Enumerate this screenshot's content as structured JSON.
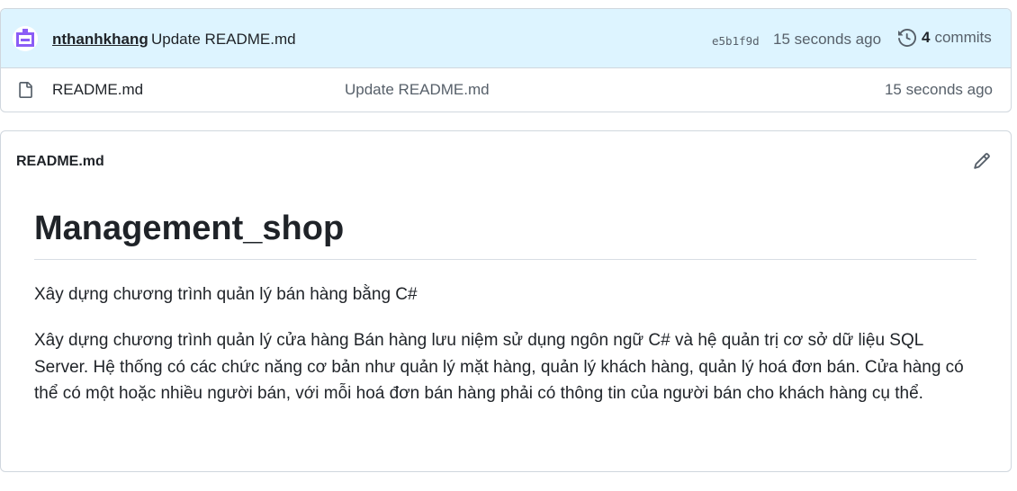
{
  "commit": {
    "author": "nthanhkhang",
    "message": "Update README.md",
    "sha": "e5b1f9d",
    "time": "15 seconds ago",
    "history_count": "4",
    "history_label": "commits"
  },
  "files": [
    {
      "icon": "file-icon",
      "name": "README.md",
      "last_commit": "Update README.md",
      "time": "15 seconds ago"
    }
  ],
  "readme": {
    "header_title": "README.md",
    "edit_icon": "pencil-icon",
    "h1": "Management_shop",
    "paragraphs": [
      "Xây dựng chương trình quản lý bán hàng bằng C#",
      "Xây dựng chương trình quản lý cửa hàng Bán hàng lưu niệm sử dụng ngôn ngữ C# và hệ quản trị cơ sở dữ liệu SQL Server. Hệ thống có các chức năng cơ bản như quản lý mặt hàng, quản lý khách hàng, quản lý hoá đơn bán. Cửa hàng có thể có một hoặc nhiều người bán, với mỗi hoá đơn bán hàng phải có thông tin của người bán cho khách hàng cụ thể."
    ]
  },
  "colors": {
    "commit_bar_bg": "#ddf4ff",
    "border": "#d0d7de",
    "muted_text": "#57606a",
    "avatar_accent": "#8b5cf6"
  }
}
